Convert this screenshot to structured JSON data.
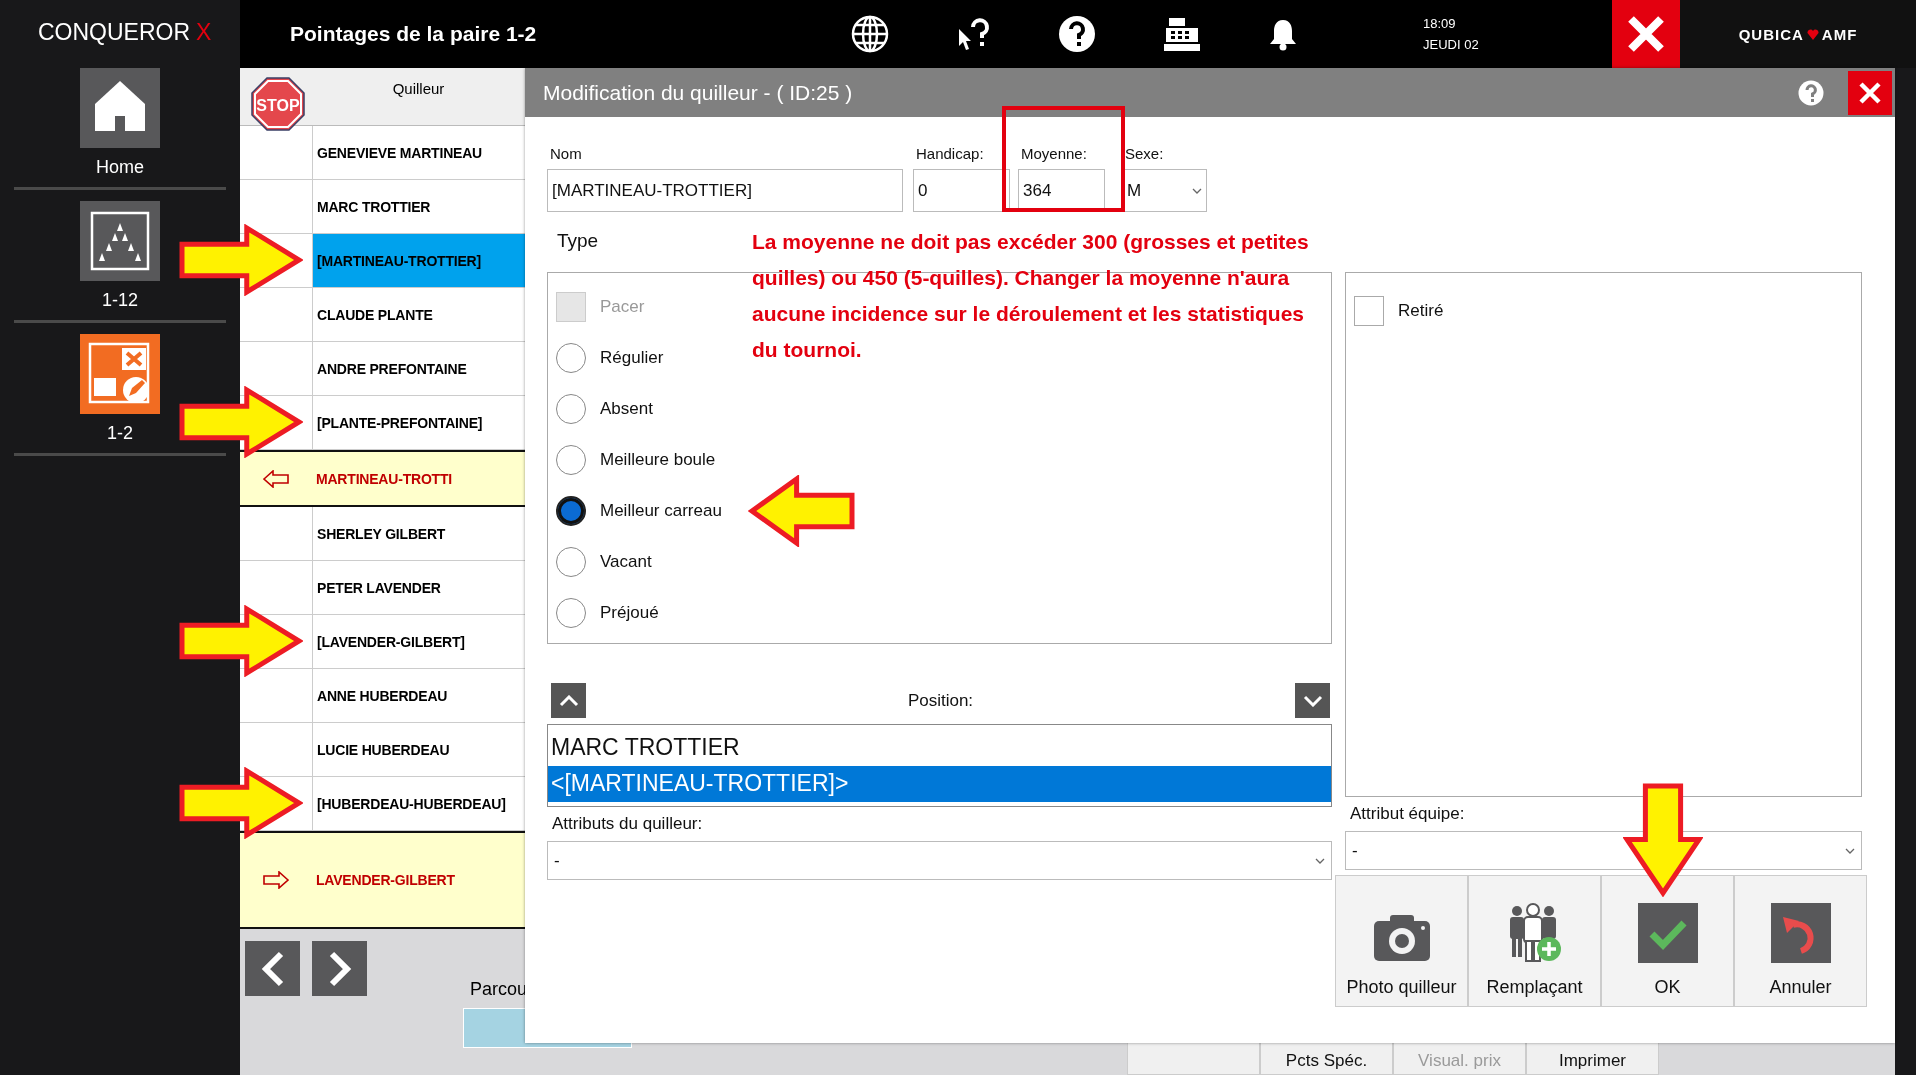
{
  "app": {
    "name": "CONQUEROR",
    "mark": "X"
  },
  "sidebar": {
    "items": [
      {
        "kind": "home",
        "label": "Home"
      },
      {
        "kind": "lanes",
        "label": "1-12"
      },
      {
        "kind": "score",
        "label": "1-2"
      }
    ]
  },
  "header": {
    "title": "Pointages de la paire 1-2",
    "time": "18:09",
    "date": "JEUDI 02",
    "brand": "QUBICA",
    "brand_2": "AMF"
  },
  "list": {
    "stop_label": "STOP",
    "column": "Quilleur",
    "rows": [
      {
        "kind": "player",
        "name": "GENEVIEVE MARTINEAU",
        "selected": false,
        "callout": false
      },
      {
        "kind": "player",
        "name": "MARC TROTTIER",
        "selected": false,
        "callout": false
      },
      {
        "kind": "player",
        "name": "[MARTINEAU-TROTTIER]",
        "selected": true,
        "callout": true
      },
      {
        "kind": "player",
        "name": "CLAUDE PLANTE",
        "selected": false,
        "callout": false
      },
      {
        "kind": "player",
        "name": "ANDRE PREFONTAINE",
        "selected": false,
        "callout": false
      },
      {
        "kind": "player",
        "name": "[PLANTE-PREFONTAINE]",
        "selected": false,
        "callout": true
      },
      {
        "kind": "previous",
        "name": "MARTINEAU-TROTTI",
        "selected": false,
        "callout": false
      },
      {
        "kind": "player",
        "name": "SHERLEY GILBERT",
        "selected": false,
        "callout": false
      },
      {
        "kind": "player",
        "name": "PETER LAVENDER",
        "selected": false,
        "callout": false
      },
      {
        "kind": "player",
        "name": "[LAVENDER-GILBERT]",
        "selected": false,
        "callout": true
      },
      {
        "kind": "player",
        "name": "ANNE HUBERDEAU",
        "selected": false,
        "callout": false
      },
      {
        "kind": "player",
        "name": "LUCIE HUBERDEAU",
        "selected": false,
        "callout": false
      },
      {
        "kind": "player",
        "name": "[HUBERDEAU-HUBERDEAU]",
        "selected": false,
        "callout": true
      },
      {
        "kind": "next",
        "name": "LAVENDER-GILBERT",
        "selected": false,
        "callout": false
      }
    ]
  },
  "footer": {
    "label": "Parcou",
    "buttons": [
      {
        "label": "Pcts Spéc.",
        "disabled": false
      },
      {
        "label": "Visual. prix",
        "disabled": true
      },
      {
        "label": "Imprimer",
        "disabled": false
      }
    ]
  },
  "dialog": {
    "title": "Modification du quilleur - ( ID:25 )",
    "fields": [
      {
        "kind": "text",
        "label": "Nom",
        "value": "[MARTINEAU-TROTTIER]",
        "highlighted": false
      },
      {
        "kind": "text",
        "label": "Handicap:",
        "value": "0",
        "highlighted": false
      },
      {
        "kind": "text",
        "label": "Moyenne:",
        "value": "364",
        "highlighted": true
      },
      {
        "kind": "select",
        "label": "Sexe:",
        "value": "M",
        "highlighted": false
      }
    ],
    "note": "La moyenne ne doit pas excéder 300 (grosses et petites quilles) ou 450 (5-quilles).  Changer la moyenne n'aura aucune incidence sur le déroulement et les statistiques du tournoi.",
    "type": {
      "label": "Type",
      "options": [
        {
          "kind": "checkbox",
          "label": "Pacer",
          "checked": false,
          "disabled": true,
          "callout": false
        },
        {
          "kind": "radio",
          "label": "Régulier",
          "selected": false,
          "callout": false
        },
        {
          "kind": "radio",
          "label": "Absent",
          "selected": false,
          "callout": false
        },
        {
          "kind": "radio",
          "label": "Meilleure boule",
          "selected": false,
          "callout": false
        },
        {
          "kind": "radio",
          "label": "Meilleur carreau",
          "selected": true,
          "callout": true
        },
        {
          "kind": "radio",
          "label": "Vacant",
          "selected": false,
          "callout": false
        },
        {
          "kind": "radio",
          "label": "Préjoué",
          "selected": false,
          "callout": false
        }
      ]
    },
    "retired": {
      "label": "Retiré",
      "checked": false
    },
    "position": {
      "label": "Position:",
      "items": [
        {
          "label": "MARC TROTTIER",
          "selected": false
        },
        {
          "label": "<[MARTINEAU-TROTTIER]>",
          "selected": true
        }
      ]
    },
    "bowler_attribute": {
      "label": "Attributs du quilleur:",
      "value": "-"
    },
    "team_attribute": {
      "label": "Attribut équipe:",
      "value": "-"
    },
    "buttons": [
      {
        "kind": "camera",
        "label": "Photo quilleur",
        "callout": false
      },
      {
        "kind": "people",
        "label": "Remplaçant",
        "callout": false
      },
      {
        "kind": "ok",
        "label": "OK",
        "callout": true
      },
      {
        "kind": "cancel",
        "label": "Annuler",
        "callout": false
      }
    ]
  }
}
